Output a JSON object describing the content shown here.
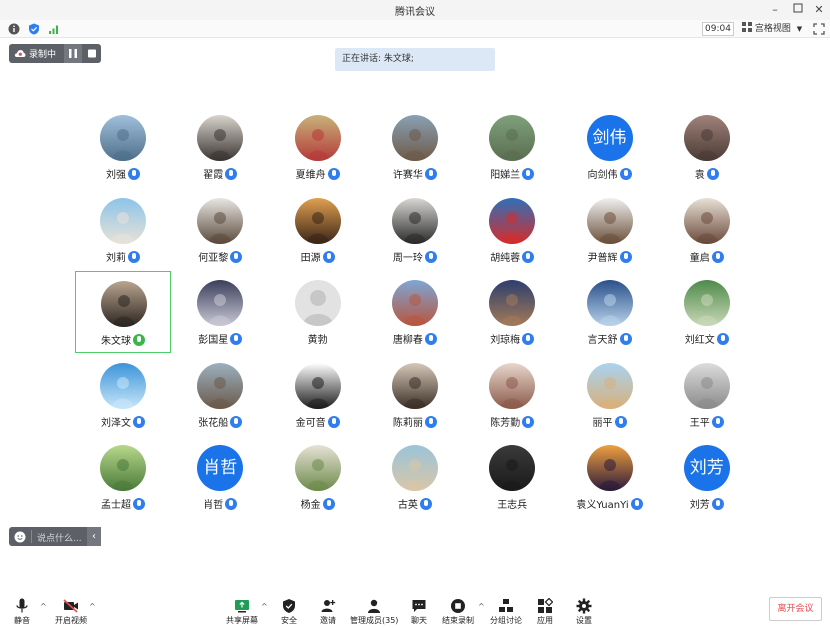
{
  "window": {
    "title": "腾讯会议"
  },
  "status": {
    "clock": "09:04",
    "view_label": "宫格视图"
  },
  "recording": {
    "label": "录制中"
  },
  "speaker": {
    "text": "正在讲话: 朱文球;"
  },
  "chat": {
    "placeholder": "说点什么..."
  },
  "participants": [
    {
      "name": "刘强",
      "mic": "blue",
      "avatar": "photo",
      "colors": [
        "#9fbfdb",
        "#4f6f8a"
      ]
    },
    {
      "name": "翟霞",
      "mic": "blue",
      "avatar": "photo",
      "colors": [
        "#d8d3cc",
        "#3b3532"
      ]
    },
    {
      "name": "夏维舟",
      "mic": "blue",
      "avatar": "photo",
      "colors": [
        "#c8b27a",
        "#b43a3a"
      ]
    },
    {
      "name": "许赛华",
      "mic": "blue",
      "avatar": "photo",
      "colors": [
        "#8aa0b4",
        "#6d5a48"
      ]
    },
    {
      "name": "阳娣兰",
      "mic": "blue",
      "avatar": "photo",
      "colors": [
        "#7fa07a",
        "#5a6e50"
      ]
    },
    {
      "name": "向剑伟",
      "mic": "blue",
      "avatar": "text",
      "text": "剑伟",
      "colors": [
        "#1a73e8",
        "#1a73e8"
      ]
    },
    {
      "name": "袁",
      "mic": "blue",
      "avatar": "photo",
      "colors": [
        "#a0837b",
        "#4a3a34"
      ]
    },
    {
      "name": "刘莉",
      "mic": "blue",
      "avatar": "photo",
      "colors": [
        "#8cc4e8",
        "#e8e2d8"
      ]
    },
    {
      "name": "何亚黎",
      "mic": "blue",
      "avatar": "photo",
      "colors": [
        "#e8e6e2",
        "#5b4a3c"
      ]
    },
    {
      "name": "田源",
      "mic": "blue",
      "avatar": "photo",
      "colors": [
        "#e0a050",
        "#3a2418"
      ]
    },
    {
      "name": "周一玲",
      "mic": "blue",
      "avatar": "photo",
      "colors": [
        "#d9d7d4",
        "#2a2a2a"
      ]
    },
    {
      "name": "胡纯蓉",
      "mic": "blue",
      "avatar": "photo",
      "colors": [
        "#2f6fb8",
        "#d62c2c"
      ]
    },
    {
      "name": "尹普辉",
      "mic": "blue",
      "avatar": "photo",
      "colors": [
        "#f0f0f0",
        "#6b4f3a"
      ]
    },
    {
      "name": "童启",
      "mic": "blue",
      "avatar": "photo",
      "colors": [
        "#e8e0d6",
        "#6a4a3a"
      ]
    },
    {
      "name": "朱文球",
      "mic": "green",
      "avatar": "photo",
      "active": true,
      "colors": [
        "#b9a58f",
        "#2c2420"
      ]
    },
    {
      "name": "彭国星",
      "mic": "blue",
      "avatar": "photo",
      "colors": [
        "#3a3f5a",
        "#c9c9d6"
      ]
    },
    {
      "name": "黄勃",
      "mic": "none",
      "avatar": "default",
      "colors": [
        "#e2e2e2",
        "#c7c7c7"
      ]
    },
    {
      "name": "唐柳春",
      "mic": "blue",
      "avatar": "photo",
      "colors": [
        "#7ea6d4",
        "#b8553f"
      ]
    },
    {
      "name": "刘琼梅",
      "mic": "blue",
      "avatar": "photo",
      "colors": [
        "#2d3e6e",
        "#a37a59"
      ]
    },
    {
      "name": "言天舒",
      "mic": "blue",
      "avatar": "photo",
      "colors": [
        "#2a4f8a",
        "#b8d2ea"
      ]
    },
    {
      "name": "刘红文",
      "mic": "blue",
      "avatar": "photo",
      "colors": [
        "#4f8a4a",
        "#c8d8b8"
      ]
    },
    {
      "name": "刘泽文",
      "mic": "blue",
      "avatar": "photo",
      "colors": [
        "#3c94d8",
        "#c8e6fa"
      ]
    },
    {
      "name": "张花船",
      "mic": "blue",
      "avatar": "photo",
      "colors": [
        "#9cb0bf",
        "#6b5a4a"
      ]
    },
    {
      "name": "金可音",
      "mic": "blue",
      "avatar": "photo",
      "colors": [
        "#ffffff",
        "#1d1d1d"
      ]
    },
    {
      "name": "陈莉丽",
      "mic": "blue",
      "avatar": "photo",
      "colors": [
        "#d6c8b8",
        "#3a2e26"
      ]
    },
    {
      "name": "陈芳勤",
      "mic": "blue",
      "avatar": "photo",
      "colors": [
        "#e8d6cc",
        "#8a5a4a"
      ]
    },
    {
      "name": "丽平",
      "mic": "blue",
      "avatar": "photo",
      "colors": [
        "#a9d3f0",
        "#d8b07a"
      ]
    },
    {
      "name": "王平",
      "mic": "blue",
      "avatar": "photo",
      "colors": [
        "#dcdcdc",
        "#8a8a8a"
      ]
    },
    {
      "name": "孟士超",
      "mic": "blue",
      "avatar": "photo",
      "colors": [
        "#b7d88a",
        "#4a7a3a"
      ]
    },
    {
      "name": "肖哲",
      "mic": "blue",
      "avatar": "text",
      "text": "肖哲",
      "colors": [
        "#1a73e8",
        "#1a73e8"
      ]
    },
    {
      "name": "杨金",
      "mic": "blue",
      "avatar": "photo",
      "colors": [
        "#e6e2d6",
        "#6d8a4a"
      ]
    },
    {
      "name": "古英",
      "mic": "blue",
      "avatar": "photo",
      "colors": [
        "#9bc4d8",
        "#d8c6a8"
      ]
    },
    {
      "name": "王志兵",
      "mic": "none",
      "avatar": "photo",
      "colors": [
        "#3a3a3a",
        "#1a1a1a"
      ]
    },
    {
      "name": "袁义YuanYi",
      "mic": "blue",
      "avatar": "photo",
      "colors": [
        "#f0a040",
        "#2a1a3a"
      ]
    },
    {
      "name": "刘芳",
      "mic": "blue",
      "avatar": "text",
      "text": "刘芳",
      "colors": [
        "#1a73e8",
        "#1a73e8"
      ]
    }
  ],
  "toolbar": {
    "mute": "静音",
    "video": "开启视频",
    "share": "共享屏幕",
    "security": "安全",
    "invite": "邀请",
    "members": "管理成员(35)",
    "chat": "聊天",
    "end_record": "结束录制",
    "breakout": "分组讨论",
    "apps": "应用",
    "settings": "设置",
    "leave": "离开会议"
  },
  "colors": {
    "accent": "#1a73e8",
    "leave": "#e34d4d",
    "active_border": "#4ccf6a"
  }
}
